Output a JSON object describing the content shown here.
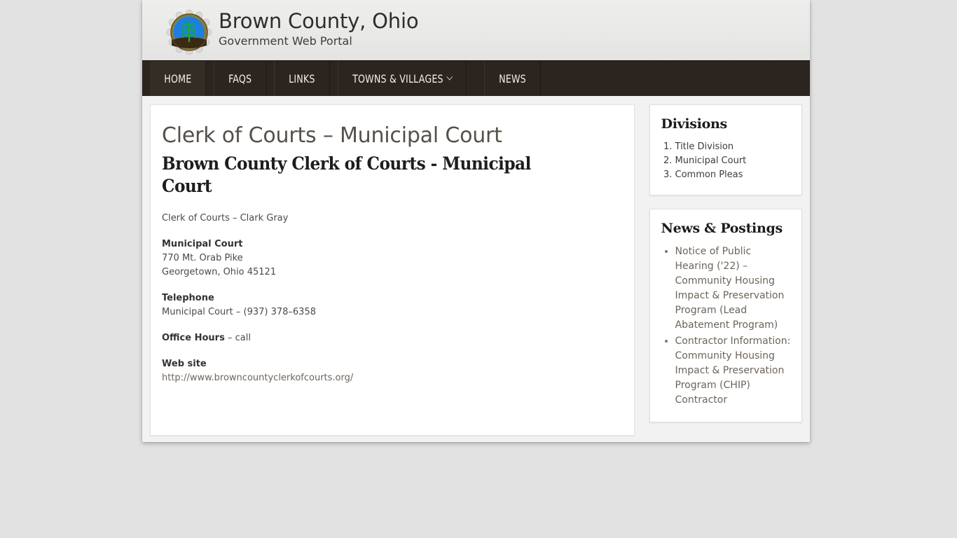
{
  "header": {
    "logo_name": "brown-county-seal",
    "title": "Brown County, Ohio",
    "tagline": "Government Web Portal"
  },
  "nav": {
    "items": [
      {
        "label": "HOME",
        "active": true,
        "has_dropdown": false
      },
      {
        "label": "FAQS",
        "active": false,
        "has_dropdown": false
      },
      {
        "label": "LINKS",
        "active": false,
        "has_dropdown": false
      },
      {
        "label": "TOWNS & VILLAGES",
        "active": false,
        "has_dropdown": true
      },
      {
        "label": "NEWS",
        "active": false,
        "has_dropdown": false
      }
    ]
  },
  "main": {
    "page_title": "Clerk of Courts – Municipal Court",
    "entry_heading": "Brown County Clerk of Courts - Municipal Court",
    "clerk_line": "Clerk of Courts – Clark Gray",
    "office_label": "Municipal Court",
    "address_line1": "770 Mt. Orab Pike",
    "address_line2": "Georgetown, Ohio 45121",
    "telephone_label": "Telephone",
    "telephone_value": "Municipal Court – (937) 378–6358",
    "office_hours_label": "Office Hours",
    "office_hours_value": " – call",
    "website_label": "Web site",
    "website_url": "http://www.browncountyclerkofcourts.org/"
  },
  "sidebar": {
    "divisions": {
      "title": "Divisions",
      "items": [
        "Title Division",
        "Municipal Court",
        "Common Pleas"
      ]
    },
    "news": {
      "title": "News & Postings",
      "items": [
        "Notice of Public Hearing ('22) – Community Housing Impact & Preservation Program (Lead Abatement Program)",
        "Contractor Information: Community Housing Impact & Preservation Program (CHIP) Contractor"
      ]
    }
  },
  "colors": {
    "nav_background": "#2c251f",
    "page_background": "#e2e2e2",
    "wrapper_background": "#f2f2f2",
    "title_text": "#555049",
    "link": "#6d645b"
  }
}
